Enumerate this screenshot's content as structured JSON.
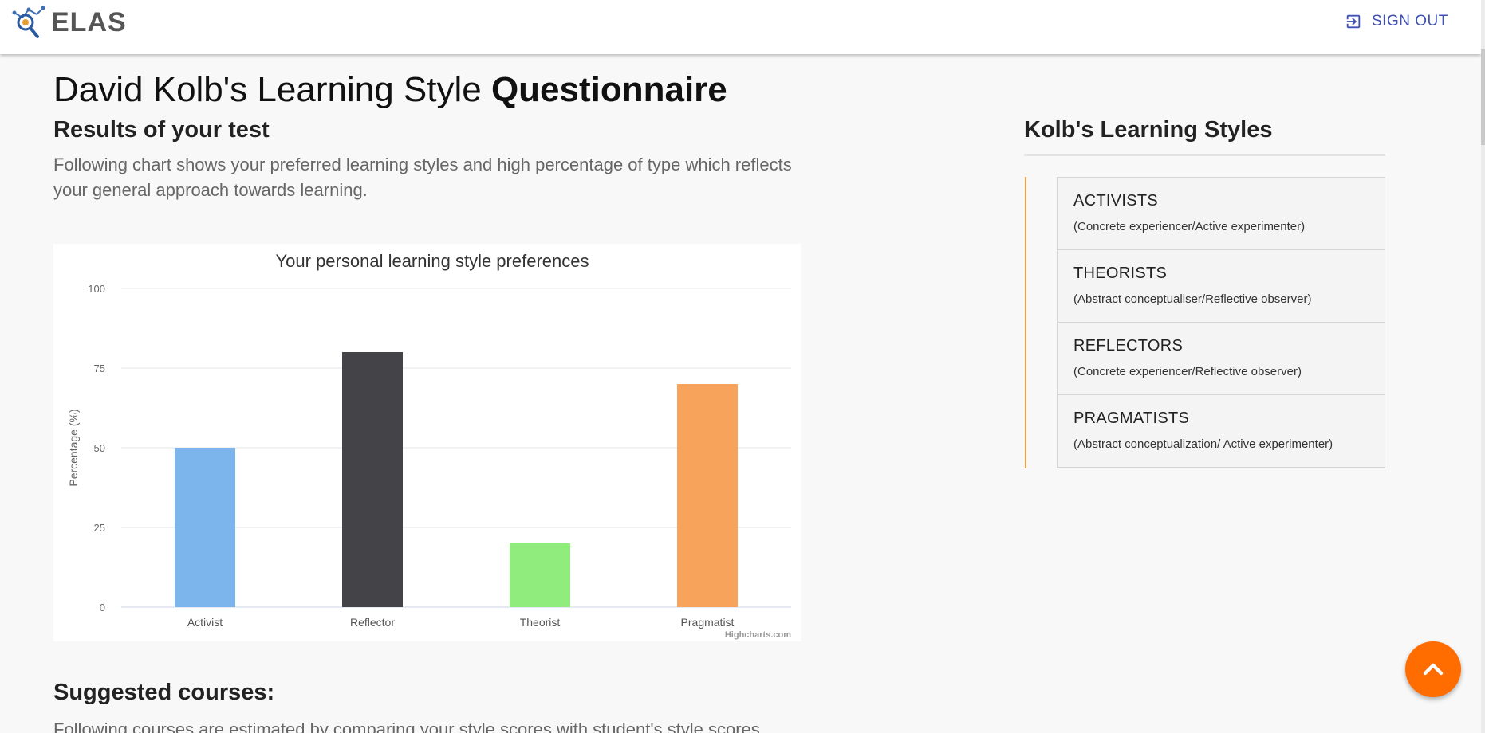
{
  "header": {
    "logo_text": "ELAS",
    "signout_label": "SIGN OUT"
  },
  "page": {
    "title_regular": "David Kolb's Learning Style ",
    "title_bold": "Questionnaire",
    "results_title": "Results of your test",
    "results_desc": "Following chart shows your preferred learning styles and high percentage of type which reflects your general approach towards learning.",
    "suggested_title": "Suggested courses:",
    "suggested_desc": "Following courses are estimated by comparing your style scores with student's style scores"
  },
  "chart_data": {
    "type": "bar",
    "title": "Your personal learning style preferences",
    "xlabel": "",
    "ylabel": "Percentage (%)",
    "ylim": [
      0,
      100
    ],
    "yticks": [
      0,
      25,
      50,
      75,
      100
    ],
    "categories": [
      "Activist",
      "Reflector",
      "Theorist",
      "Pragmatist"
    ],
    "values": [
      50,
      80,
      20,
      70
    ],
    "colors": [
      "#7cb5ec",
      "#434348",
      "#90ed7d",
      "#f7a35c"
    ],
    "credits": "Highcharts.com",
    "grid": true,
    "legend": "none"
  },
  "sidebar": {
    "title": "Kolb's Learning Styles",
    "items": [
      {
        "name": "ACTIVISTS",
        "desc": "(Concrete experiencer/Active experimenter)"
      },
      {
        "name": "THEORISTS",
        "desc": "(Abstract conceptualiser/Reflective observer)"
      },
      {
        "name": "REFLECTORS",
        "desc": "(Concrete experiencer/Reflective observer)"
      },
      {
        "name": "PRAGMATISTS",
        "desc": "(Abstract conceptualization/ Active experimenter)"
      }
    ]
  },
  "colors": {
    "accent": "#3f51b5",
    "fab": "#ff6d00",
    "timeline": "#f0a040"
  },
  "icons": {
    "logo": "magnifier-network-icon",
    "signout": "exit-icon",
    "fab": "chevron-up-icon"
  }
}
